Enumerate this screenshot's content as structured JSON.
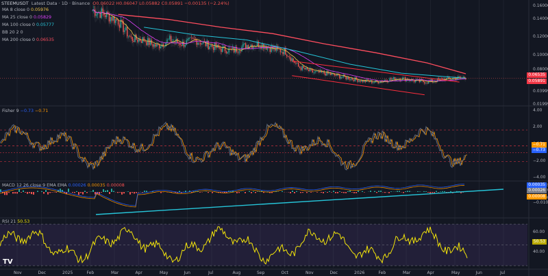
{
  "header": {
    "symbol": "STEEMUSDT",
    "source": "Latest Data · 1D · Binance",
    "ohlc": "O0.06022 H0.06047 L0.05882 C0.05891 −0.00135 (−2.24%)"
  },
  "ma_legend": [
    {
      "label": "MA 8 close 0",
      "value": "0.05976",
      "color": "#f7c948"
    },
    {
      "label": "MA 25 close 0",
      "value": "0.05829",
      "color": "#e040fb"
    },
    {
      "label": "MA 100 close 0",
      "value": "0.05777",
      "color": "#26c6da"
    },
    {
      "label": "BB 20 2 0",
      "value": "",
      "color": "#787b86"
    },
    {
      "label": "MA 200 close 0",
      "value": "0.06535",
      "color": "#ff4d5e"
    }
  ],
  "fisher_legend": {
    "label": "Fisher 9",
    "v1": "−0.73",
    "v2": "−0.71",
    "c1": "#2962ff",
    "c2": "#ff9800"
  },
  "macd_legend": {
    "label": "MACD 12 26 close 9 EMA EMA",
    "v1": "0.00026",
    "v2": "0.00035",
    "v3": "0.00008",
    "c1": "#2962ff",
    "c2": "#ff9800",
    "c3": "#ff5252"
  },
  "rsi_legend": {
    "label": "RSI 21",
    "value": "50.53",
    "color": "#f5e60a"
  },
  "price_axis": [
    "0.16000",
    "0.14000",
    "0.12000",
    "0.10000",
    "0.08000",
    "0.03999",
    "0.01999"
  ],
  "price_badges": [
    {
      "text": "0.06535",
      "color": "#f23645"
    },
    {
      "text": "0.05891",
      "color": "#f23645"
    }
  ],
  "fisher_axis": [
    "4.00",
    "2.00",
    "0.00",
    "−2.00",
    "−4.00"
  ],
  "fisher_badges": [
    {
      "text": "−0.71",
      "color": "#ff9800"
    },
    {
      "text": "−0.73",
      "color": "#2962ff"
    }
  ],
  "macd_axis": [
    "0.00035",
    "0.00026",
    "0.00008",
    "−0.01000"
  ],
  "rsi_axis": [
    "60.00",
    "50.53",
    "40.00"
  ],
  "time_axis": [
    "Nov",
    "Dec",
    "2025",
    "Feb",
    "Mar",
    "Apr",
    "May",
    "Jun",
    "Jul",
    "Aug",
    "Sep",
    "Oct",
    "Nov",
    "Dec",
    "2026",
    "Feb",
    "Mar",
    "Apr",
    "May",
    "Jun",
    "Jul"
  ],
  "logo": "TV",
  "chart_data": {
    "type": "line",
    "title": "STEEMUSDT Latest Data · 1D · Binance",
    "price_ylim": [
      0.02,
      0.17
    ],
    "price_path": [
      [
        0,
        0.165
      ],
      [
        10,
        0.158
      ],
      [
        20,
        0.148
      ],
      [
        30,
        0.12
      ],
      [
        40,
        0.118
      ],
      [
        50,
        0.108
      ],
      [
        60,
        0.118
      ],
      [
        70,
        0.112
      ],
      [
        80,
        0.118
      ],
      [
        90,
        0.11
      ],
      [
        100,
        0.104
      ],
      [
        110,
        0.102
      ],
      [
        120,
        0.11
      ],
      [
        130,
        0.112
      ],
      [
        140,
        0.104
      ],
      [
        150,
        0.1
      ],
      [
        160,
        0.076
      ],
      [
        170,
        0.068
      ],
      [
        180,
        0.066
      ],
      [
        190,
        0.062
      ],
      [
        200,
        0.058
      ],
      [
        210,
        0.054
      ],
      [
        220,
        0.052
      ],
      [
        230,
        0.056
      ],
      [
        240,
        0.058
      ],
      [
        250,
        0.054
      ],
      [
        260,
        0.052
      ],
      [
        270,
        0.056
      ],
      [
        280,
        0.058
      ],
      [
        290,
        0.059
      ]
    ],
    "ma200_path": [
      [
        20,
        0.158
      ],
      [
        60,
        0.15
      ],
      [
        100,
        0.138
      ],
      [
        140,
        0.128
      ],
      [
        180,
        0.112
      ],
      [
        220,
        0.098
      ],
      [
        260,
        0.082
      ],
      [
        290,
        0.065
      ]
    ],
    "ma100_path": [
      [
        40,
        0.138
      ],
      [
        80,
        0.126
      ],
      [
        120,
        0.118
      ],
      [
        160,
        0.1
      ],
      [
        200,
        0.08
      ],
      [
        240,
        0.066
      ],
      [
        290,
        0.058
      ]
    ],
    "fisher_ylim": [
      -4.2,
      4.6
    ],
    "rsi_ylim": [
      28,
      74
    ],
    "series": [
      {
        "name": "MA 8 close 0",
        "values": [
          0.05976
        ]
      },
      {
        "name": "MA 25 close 0",
        "values": [
          0.05829
        ]
      },
      {
        "name": "MA 100 close 0",
        "values": [
          0.05777
        ]
      },
      {
        "name": "MA 200 close 0",
        "values": [
          0.06535
        ]
      },
      {
        "name": "Fisher 9",
        "values": [
          -0.73,
          -0.71
        ]
      },
      {
        "name": "MACD 12 26 close 9 EMA EMA",
        "values": [
          0.00026,
          0.00035,
          8e-05
        ]
      },
      {
        "name": "RSI 21",
        "values": [
          50.53
        ]
      }
    ]
  }
}
